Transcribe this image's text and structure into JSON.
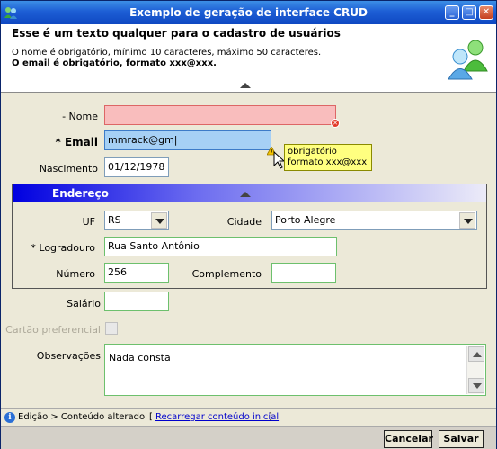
{
  "window": {
    "title": "Exemplo de geração de interface CRUD",
    "controls": [
      "minimize",
      "maximize",
      "close"
    ]
  },
  "header": {
    "title": "Esse é um texto qualquer para o cadastro de usuários",
    "line1": "O nome é obrigatório, mínimo 10 caracteres, máximo 50 caracteres.",
    "line2": "O email é obrigatório, formato xxx@xxx.",
    "icon": "users-icon"
  },
  "form": {
    "nome": {
      "label": "- Nome",
      "value": ""
    },
    "email": {
      "label": "* Email",
      "value": "mmrack@gm|"
    },
    "tooltip": {
      "line1": "obrigatório",
      "line2": "formato xxx@xxx"
    },
    "nascimento": {
      "label": "Nascimento",
      "value": "01/12/1978"
    },
    "endereco": {
      "title": "Endereço",
      "uf": {
        "label": "UF",
        "value": "RS"
      },
      "cidade": {
        "label": "Cidade",
        "value": "Porto Alegre"
      },
      "logradouro": {
        "label": "* Logradouro",
        "value": "Rua Santo Antônio"
      },
      "numero": {
        "label": "Número",
        "value": "256"
      },
      "complemento": {
        "label": "Complemento",
        "value": ""
      }
    },
    "salario": {
      "label": "Salário",
      "value": ""
    },
    "cartao": {
      "label": "Cartão preferencial"
    },
    "observacoes": {
      "label": "Observações",
      "value": "Nada consta"
    }
  },
  "status": {
    "text": "Edição > Conteúdo alterado",
    "bracket_open": "[",
    "link": "Recarregar conteúdo inicial",
    "bracket_close": "]"
  },
  "buttons": {
    "cancel": "Cancelar",
    "save": "Salvar"
  },
  "colors": {
    "title_bar": "#1d5ed5",
    "error_field": "#f9bdbd",
    "focus_field": "#a6d0f5",
    "valid_border": "#6dc06d",
    "tooltip": "#ffff80",
    "section_header": "#0000e0"
  }
}
